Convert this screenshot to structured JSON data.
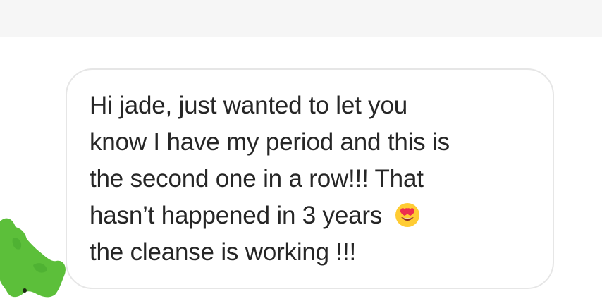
{
  "message": {
    "lines": [
      "Hi jade, just wanted to let you",
      "know I have my period and this is",
      "the second one in a row!!! That",
      "hasn’t happened in 3 years",
      "the cleanse is working !!!"
    ],
    "emoji": "smiling-face-with-heart-eyes"
  },
  "colors": {
    "text": "#262626",
    "bubble_border": "#e6e6e6",
    "top_bar": "#f6f6f6",
    "avatar_scribble": "#5cbf3a"
  }
}
